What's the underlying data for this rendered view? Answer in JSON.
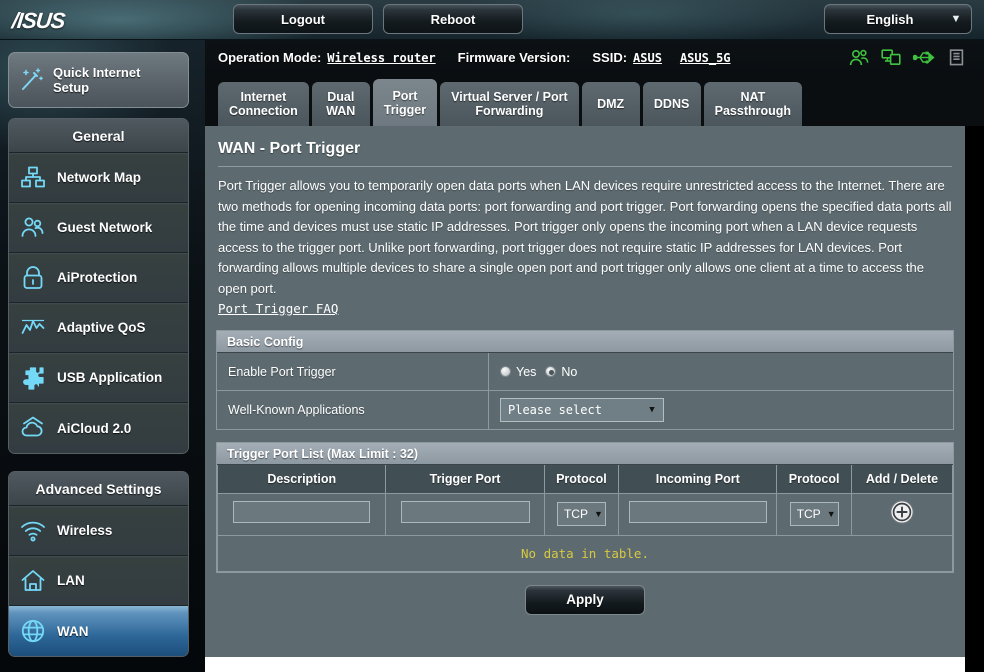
{
  "brand": {
    "logo_text": "/ISUS"
  },
  "topbar": {
    "logout_label": "Logout",
    "reboot_label": "Reboot",
    "language": "English",
    "caret": "▼"
  },
  "status": {
    "operation_mode_label": "Operation Mode:",
    "operation_mode_value": "Wireless router",
    "firmware_label": "Firmware Version:",
    "firmware_value": "",
    "ssid_label": "SSID:",
    "ssid_1": "ASUS",
    "ssid_2": "ASUS_5G",
    "icons": [
      "clients-icon",
      "devices-icon",
      "usb-icon",
      "printer-icon"
    ]
  },
  "tabs": [
    {
      "line1": "Internet",
      "line2": "Connection",
      "active": false
    },
    {
      "line1": "Dual",
      "line2": "WAN",
      "active": false
    },
    {
      "line1": "Port",
      "line2": "Trigger",
      "active": true
    },
    {
      "line1": "Virtual Server / Port",
      "line2": "Forwarding",
      "active": false
    },
    {
      "line1": "DMZ",
      "line2": "",
      "active": false
    },
    {
      "line1": "DDNS",
      "line2": "",
      "active": false
    },
    {
      "line1": "NAT",
      "line2": "Passthrough",
      "active": false
    }
  ],
  "sidebar": {
    "quick_setup": {
      "line1": "Quick Internet",
      "line2": "Setup",
      "icon": "magic-wand-icon"
    },
    "general_header": "General",
    "general_items": [
      {
        "label": "Network Map",
        "icon": "network-map-icon"
      },
      {
        "label": "Guest Network",
        "icon": "guest-network-icon"
      },
      {
        "label": "AiProtection",
        "icon": "shield-lock-icon"
      },
      {
        "label": "Adaptive QoS",
        "icon": "qos-chart-icon"
      },
      {
        "label": "USB Application",
        "icon": "puzzle-icon"
      },
      {
        "label": "AiCloud 2.0",
        "icon": "cloud-icon"
      }
    ],
    "advanced_header": "Advanced Settings",
    "advanced_items": [
      {
        "label": "Wireless",
        "icon": "wifi-icon",
        "selected": false
      },
      {
        "label": "LAN",
        "icon": "home-icon",
        "selected": false
      },
      {
        "label": "WAN",
        "icon": "globe-icon",
        "selected": true
      }
    ]
  },
  "main": {
    "page_title": "WAN - Port Trigger",
    "description": "Port Trigger allows you to temporarily open data ports when LAN devices require unrestricted access to the Internet. There are two methods for opening incoming data ports: port forwarding and port trigger. Port forwarding opens the specified data ports all the time and devices must use static IP addresses. Port trigger only opens the incoming port when a LAN device requests access to the trigger port. Unlike port forwarding, port trigger does not require static IP addresses for LAN devices. Port forwarding allows multiple devices to share a single open port and port trigger only allows one client at a time to access the open port.",
    "faq_link": "Port Trigger FAQ",
    "basic_config": {
      "header": "Basic Config",
      "enable_label": "Enable Port Trigger",
      "radio_yes": "Yes",
      "radio_no": "No",
      "selected": "No",
      "wka_label": "Well-Known Applications",
      "wka_value": "Please select",
      "caret": "▼"
    },
    "trigger_list": {
      "header": "Trigger Port List (Max Limit : 32)",
      "columns": [
        "Description",
        "Trigger Port",
        "Protocol",
        "Incoming Port",
        "Protocol",
        "Add / Delete"
      ],
      "input_row": {
        "description": "",
        "trigger_port": "",
        "protocol_1": "TCP",
        "incoming_port": "",
        "protocol_2": "TCP",
        "add_icon": "plus-circle-icon",
        "caret": "▼"
      },
      "empty_message": "No data in table."
    },
    "apply_label": "Apply"
  },
  "colors": {
    "accent_blue": "#2d6798",
    "content_bg": "#5d6b71",
    "panel_header": "#9aa5ae",
    "table_header": "#414f54",
    "warning_text": "#d8c840",
    "icon_green": "#3fc23f"
  }
}
